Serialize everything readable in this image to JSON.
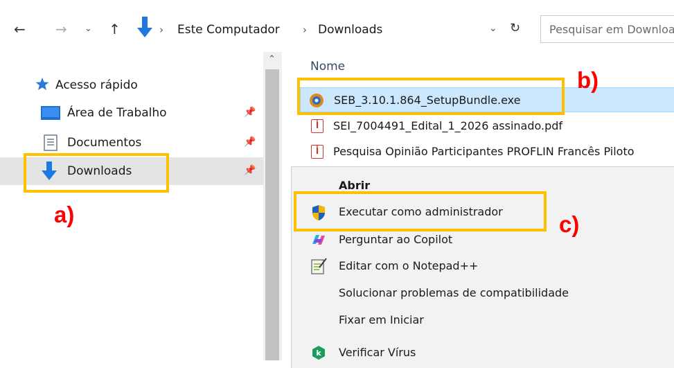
{
  "address_bar": {
    "breadcrumbs": [
      "Este Computador",
      "Downloads"
    ],
    "search_placeholder": "Pesquisar em Downloads"
  },
  "nav_pane": {
    "quick_access_label": "Acesso rápido",
    "items": [
      {
        "label": "Área de Trabalho",
        "icon": "desktop-icon",
        "pinned": true
      },
      {
        "label": "Documentos",
        "icon": "documents-icon",
        "pinned": true
      },
      {
        "label": "Downloads",
        "icon": "downloads-icon",
        "pinned": true,
        "selected": true
      }
    ]
  },
  "file_list": {
    "column_header": "Nome",
    "files": [
      {
        "name": "SEB_3.10.1.864_SetupBundle.exe",
        "icon": "exe-icon",
        "selected": true
      },
      {
        "name": "SEI_7004491_Edital_1_2026 assinado.pdf",
        "icon": "pdf-icon"
      },
      {
        "name": "Pesquisa Opinião Participantes PROFLIN Francês Piloto",
        "icon": "pdf-icon"
      }
    ]
  },
  "context_menu": {
    "items": [
      {
        "label": "Abrir",
        "bold": true
      },
      {
        "label": "Executar como administrador",
        "icon": "uac-shield-icon"
      },
      {
        "label": "Perguntar ao Copilot",
        "icon": "copilot-icon"
      },
      {
        "label": "Editar com o Notepad++",
        "icon": "notepadpp-icon"
      },
      {
        "label": "Solucionar problemas de compatibilidade"
      },
      {
        "label": "Fixar em Iniciar"
      },
      {
        "label": "Verificar Vírus",
        "icon": "kaspersky-icon"
      }
    ]
  },
  "annotations": {
    "a": "a)",
    "b": "b)",
    "c": "c)",
    "highlight_color": "#ffc000",
    "label_color": "#ff0000"
  },
  "colors": {
    "selection_blue": "#cce8ff",
    "nav_selected": "#e4e4e4",
    "menu_background": "#f2f2f2",
    "download_arrow": "#1e7ae0"
  }
}
